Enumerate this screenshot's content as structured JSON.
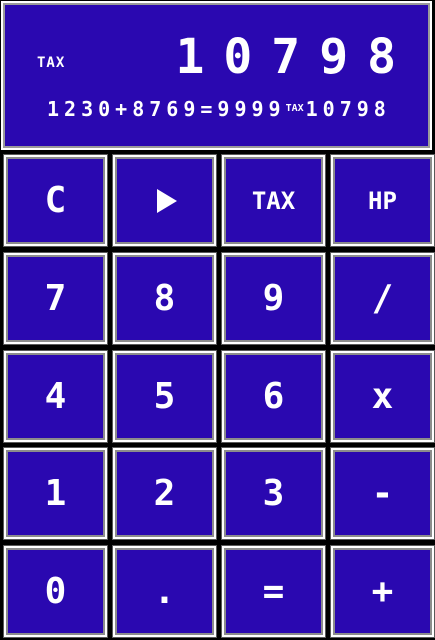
{
  "display": {
    "tax_indicator": "TAX",
    "main_value": "10798",
    "expression_before_tax": "1230+8769=9999",
    "expression_tax_mark": "TAX",
    "expression_after_tax": "10798"
  },
  "keys": {
    "clear": "C",
    "tax": "TAX",
    "hp": "HP",
    "seven": "7",
    "eight": "8",
    "nine": "9",
    "divide": "/",
    "four": "4",
    "five": "5",
    "six": "6",
    "multiply": "x",
    "one": "1",
    "two": "2",
    "three": "3",
    "subtract": "-",
    "zero": "0",
    "decimal": ".",
    "equals": "=",
    "add": "+"
  },
  "icons": {
    "play": "play-icon"
  },
  "colors": {
    "key_background": "#2a08b0",
    "text": "#ffffff",
    "background": "#000000"
  }
}
